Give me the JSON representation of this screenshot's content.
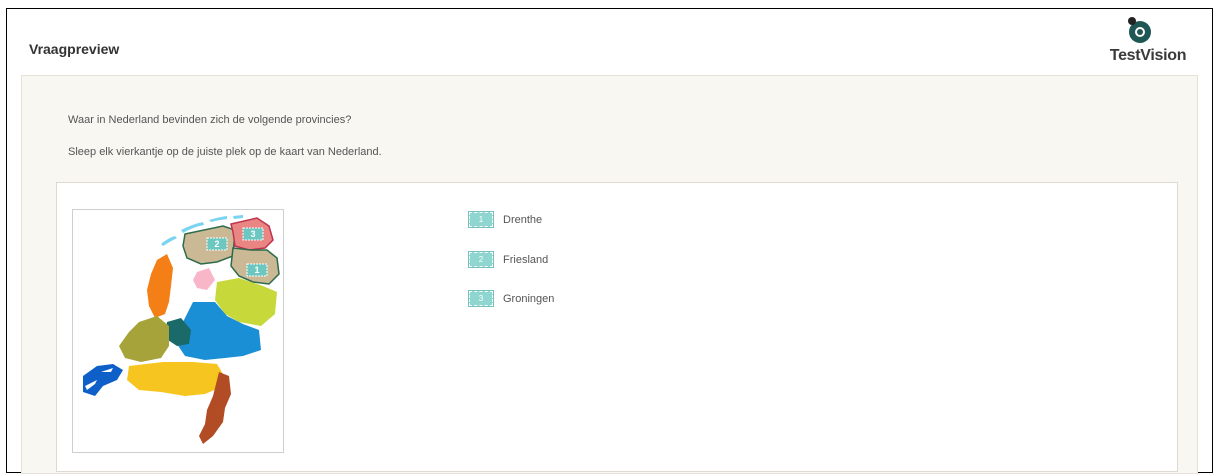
{
  "header": {
    "title": "Vraagpreview",
    "brand": "TestVision"
  },
  "question": {
    "line1": "Waar in Nederland bevinden zich de volgende provincies?",
    "line2": "Sleep elk vierkantje op de juiste plek op de kaart van Nederland."
  },
  "map": {
    "drop_markers": [
      "3",
      "2",
      "1"
    ]
  },
  "options": [
    {
      "number": "1",
      "label": "Drenthe"
    },
    {
      "number": "2",
      "label": "Friesland"
    },
    {
      "number": "3",
      "label": "Groningen"
    }
  ],
  "colors": {
    "accent": "#6cc7c1",
    "panel_bg": "#f9f7f2",
    "brand_dark": "#1d4a4a"
  }
}
